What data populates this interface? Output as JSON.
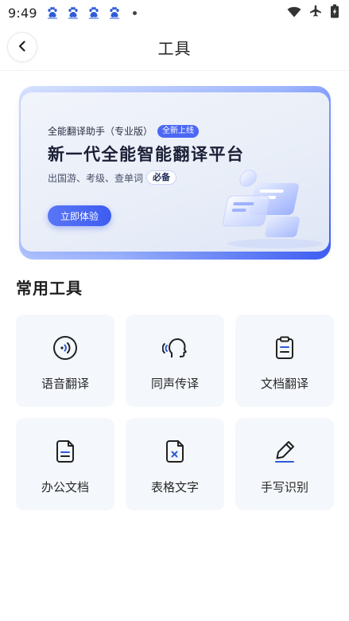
{
  "status_bar": {
    "time": "9:49",
    "app_icons": [
      "baidu-paw-icon",
      "baidu-paw-icon",
      "baidu-paw-icon",
      "baidu-paw-icon"
    ],
    "right_icons": [
      "wifi-icon",
      "airplane-icon",
      "battery-icon"
    ]
  },
  "header": {
    "title": "工具"
  },
  "banner": {
    "subtitle": "全能翻译助手（专业版）",
    "new_badge": "全新上线",
    "headline": "新一代全能智能翻译平台",
    "tagline": "出国游、考级、查单词",
    "must_badge": "必备",
    "cta": "立即体验"
  },
  "section": {
    "title": "常用工具"
  },
  "tools": [
    {
      "label": "语音翻译",
      "icon": "voice-translate-icon"
    },
    {
      "label": "同声传译",
      "icon": "simultaneous-interpret-icon"
    },
    {
      "label": "文档翻译",
      "icon": "document-translate-icon"
    },
    {
      "label": "办公文档",
      "icon": "office-document-icon"
    },
    {
      "label": "表格文字",
      "icon": "spreadsheet-text-icon"
    },
    {
      "label": "手写识别",
      "icon": "handwriting-recognition-icon"
    }
  ],
  "colors": {
    "accent": "#3d5cf0",
    "card_bg": "#f4f7fb",
    "icon_stroke": "#222222"
  }
}
